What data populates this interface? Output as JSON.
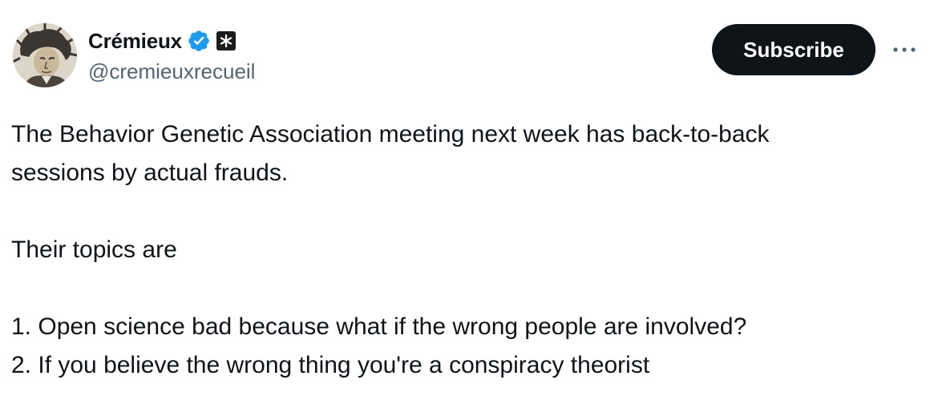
{
  "author": {
    "display_name": "Crémieux",
    "handle": "@cremieuxrecueil",
    "verified": true,
    "verified_color": "#1d9bf0",
    "affiliate_badge": "asterisk-badge-icon"
  },
  "actions": {
    "subscribe_label": "Subscribe",
    "more_icon": "ellipsis-icon"
  },
  "post": {
    "line1": "The Behavior Genetic Association meeting next week has back-to-back",
    "line2": "sessions by actual frauds.",
    "line3": "Their topics are",
    "line4": "1. Open science bad because what if the wrong people are involved?",
    "line5": "2. If you believe the wrong thing you're a conspiracy theorist"
  }
}
